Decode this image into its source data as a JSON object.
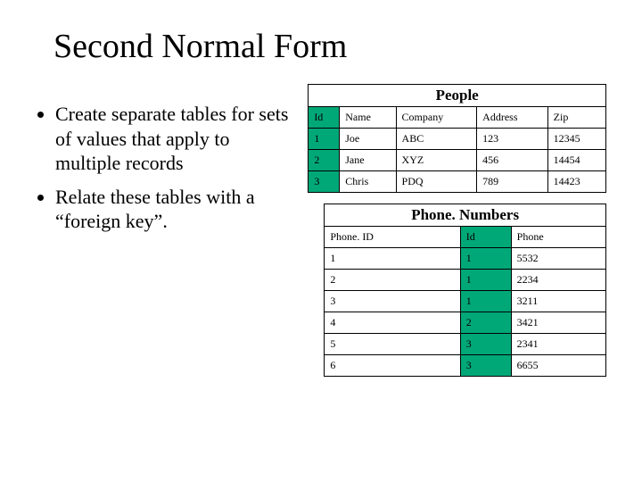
{
  "title": "Second Normal Form",
  "bullets": [
    "Create separate tables for sets of values that apply to multiple records",
    "Relate these tables with a “foreign key”."
  ],
  "people": {
    "title": "People",
    "headers": [
      "Id",
      "Name",
      "Company",
      "Address",
      "Zip"
    ],
    "rows": [
      {
        "id": "1",
        "name": "Joe",
        "company": "ABC",
        "address": "123",
        "zip": "12345"
      },
      {
        "id": "2",
        "name": "Jane",
        "company": "XYZ",
        "address": "456",
        "zip": "14454"
      },
      {
        "id": "3",
        "name": "Chris",
        "company": "PDQ",
        "address": "789",
        "zip": "14423"
      }
    ]
  },
  "phones": {
    "title": "Phone. Numbers",
    "headers": [
      "Phone. ID",
      "Id",
      "Phone"
    ],
    "rows": [
      {
        "pid": "1",
        "id": "1",
        "phone": "5532"
      },
      {
        "pid": "2",
        "id": "1",
        "phone": "2234"
      },
      {
        "pid": "3",
        "id": "1",
        "phone": "3211"
      },
      {
        "pid": "4",
        "id": "2",
        "phone": "3421"
      },
      {
        "pid": "5",
        "id": "3",
        "phone": "2341"
      },
      {
        "pid": "6",
        "id": "3",
        "phone": "6655"
      }
    ]
  }
}
